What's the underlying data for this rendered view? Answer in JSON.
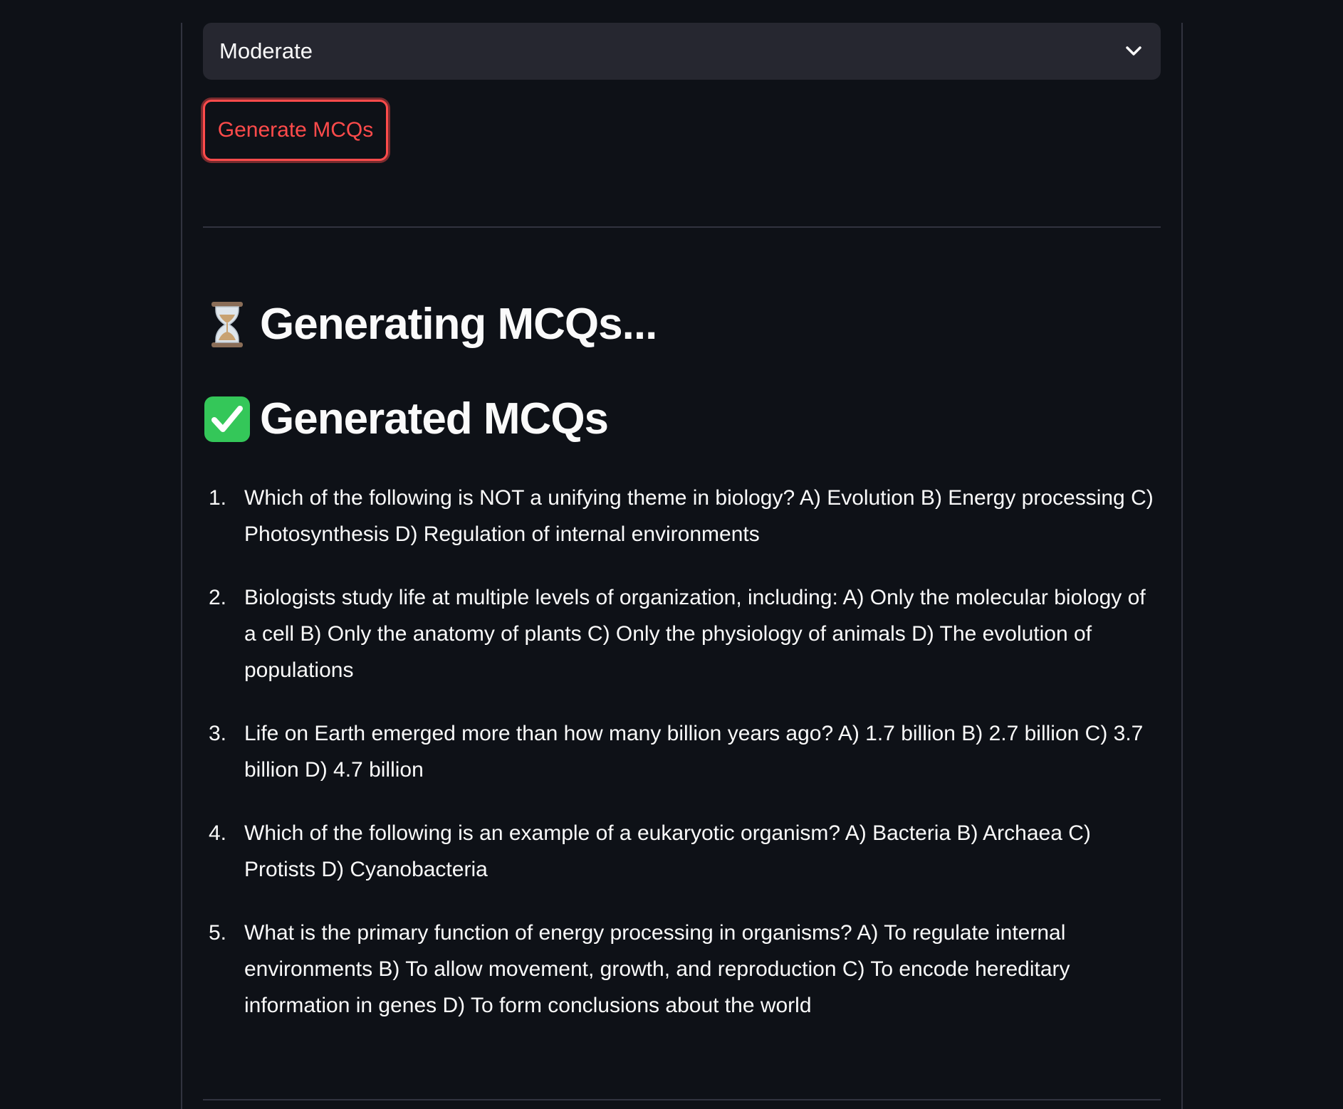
{
  "difficulty_select": {
    "value": "Moderate",
    "icon": "chevron-down-icon"
  },
  "generate_button": {
    "label": "Generate MCQs",
    "color": "#ff4b4b"
  },
  "status_heading": {
    "icon": "hourglass-icon",
    "text": "Generating MCQs..."
  },
  "result_heading": {
    "icon": "check-mark-icon",
    "text": "Generated MCQs",
    "icon_color": "#34c759"
  },
  "mcqs": [
    {
      "number": "1.",
      "text": "Which of the following is NOT a unifying theme in biology? A) Evolution B) Energy processing C) Photosynthesis D) Regulation of internal environments"
    },
    {
      "number": "2.",
      "text": "Biologists study life at multiple levels of organization, including: A) Only the molecular biology of a cell B) Only the anatomy of plants C) Only the physiology of animals D) The evolution of populations"
    },
    {
      "number": "3.",
      "text": "Life on Earth emerged more than how many billion years ago? A) 1.7 billion B) 2.7 billion C) 3.7 billion D) 4.7 billion"
    },
    {
      "number": "4.",
      "text": "Which of the following is an example of a eukaryotic organism? A) Bacteria B) Archaea C) Protists D) Cyanobacteria"
    },
    {
      "number": "5.",
      "text": "What is the primary function of energy processing in organisms? A) To regulate internal environments B) To allow movement, growth, and reproduction C) To encode hereditary information in genes D) To form conclusions about the world"
    }
  ],
  "theme": {
    "background": "#0e1117",
    "surface": "#262730",
    "border": "#31333f",
    "text": "#fafafa"
  }
}
